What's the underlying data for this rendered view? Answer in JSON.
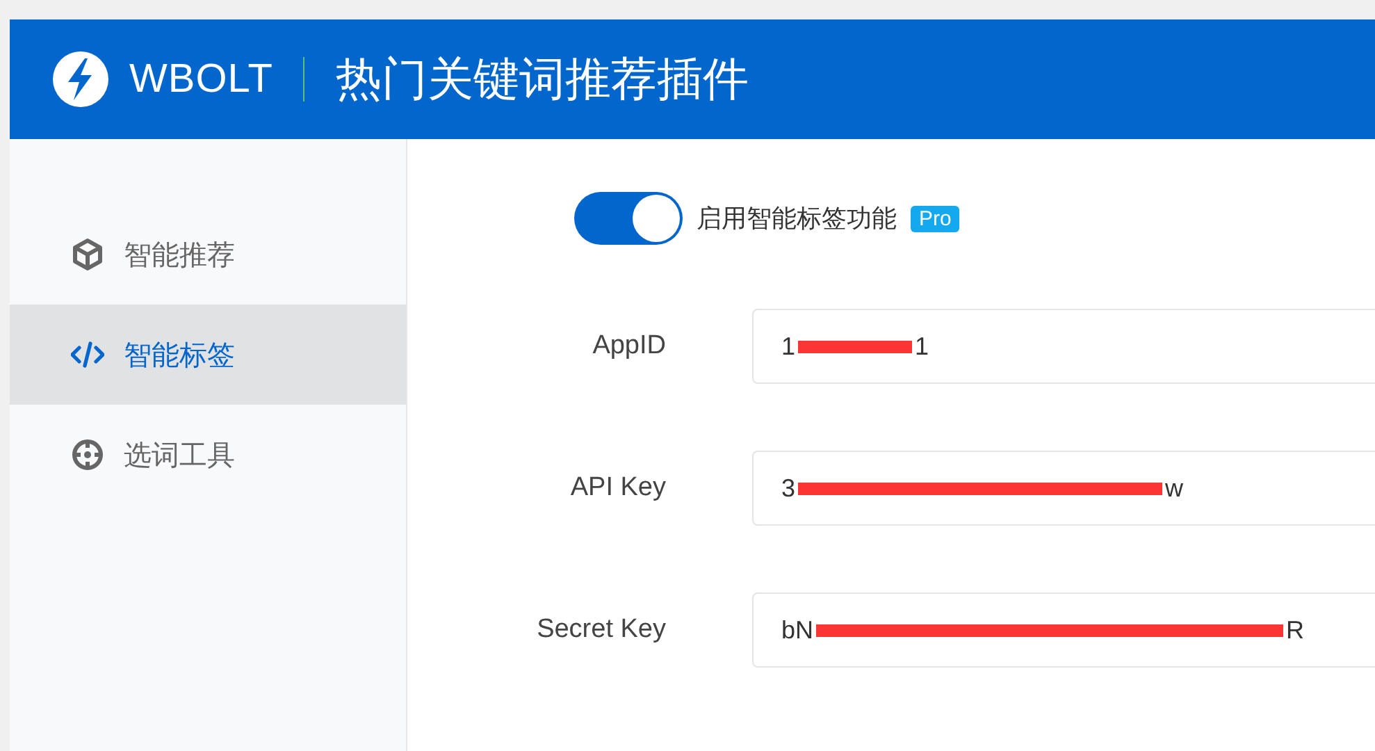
{
  "header": {
    "brand": "WBOLT",
    "title": "热门关键词推荐插件"
  },
  "sidebar": {
    "items": [
      {
        "label": "智能推荐",
        "selected": false
      },
      {
        "label": "智能标签",
        "selected": true
      },
      {
        "label": "选词工具",
        "selected": false
      }
    ]
  },
  "toggle": {
    "label": "启用智能标签功能",
    "badge": "Pro",
    "on": true
  },
  "fields": [
    {
      "label": "AppID",
      "value_start": "1",
      "value_end": "1",
      "redacted": true
    },
    {
      "label": "API Key",
      "value_start": "3",
      "value_end": "w",
      "redacted": true
    },
    {
      "label": "Secret Key",
      "value_start": "bN",
      "value_end": "R",
      "redacted": true
    }
  ]
}
